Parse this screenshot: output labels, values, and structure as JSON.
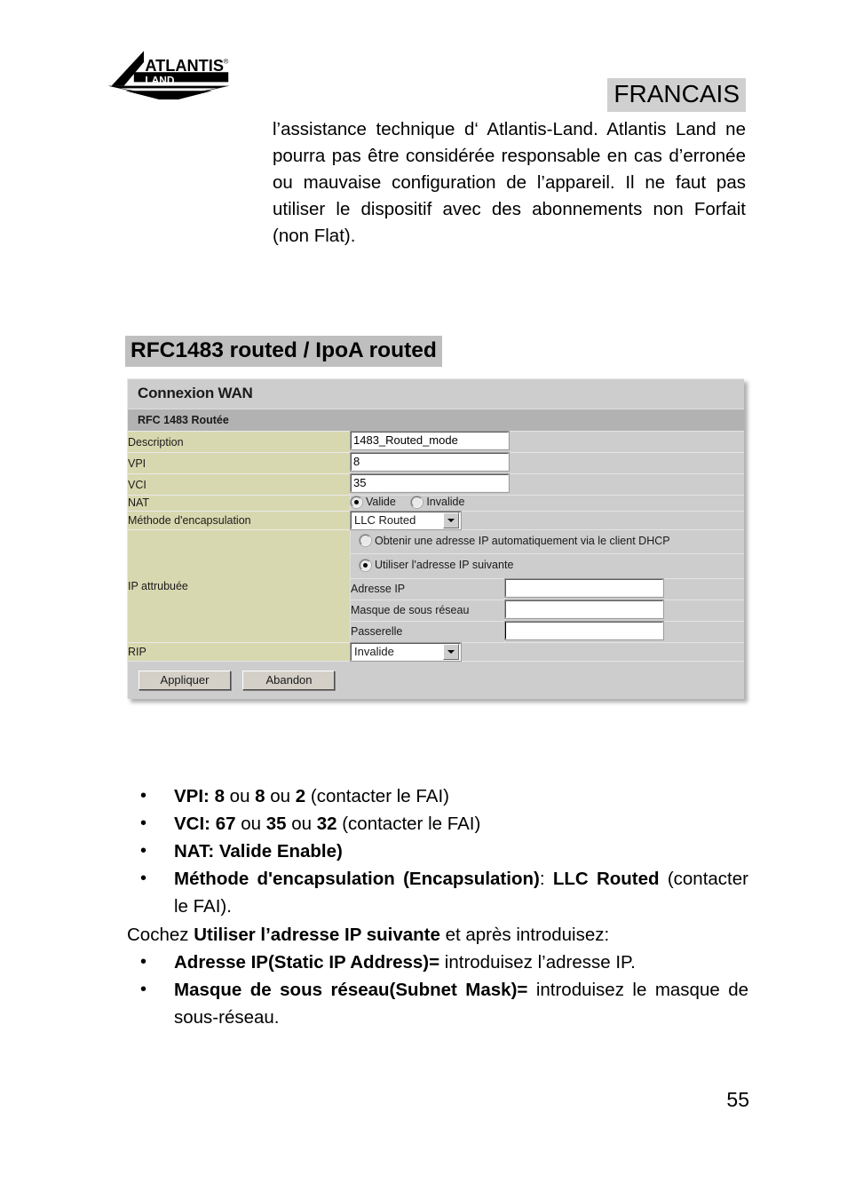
{
  "header": {
    "logo_alt": "ATLANTIS LAND",
    "logo_text_top": "ATLANTIS",
    "logo_text_bottom": "LAND",
    "logo_registered": "®",
    "language_badge": "FRANCAIS"
  },
  "intro": {
    "paragraph": "l’assistance technique d‘ Atlantis-Land. Atlantis Land ne pourra pas être considérée responsable en cas d’erronée ou mauvaise configuration de l’appareil. Il ne faut pas utiliser le dispositif avec des abonnements non Forfait (non Flat)."
  },
  "section": {
    "heading": "RFC1483 routed / IpoA routed"
  },
  "panel": {
    "title": "Connexion WAN",
    "subtitle": "RFC 1483 Routée",
    "rows": {
      "description": {
        "label": "Description",
        "value": "1483_Routed_mode"
      },
      "vpi": {
        "label": "VPI",
        "value": "8"
      },
      "vci": {
        "label": "VCI",
        "value": "35"
      },
      "nat": {
        "label": "NAT",
        "options": [
          {
            "label": "Valide",
            "selected": true
          },
          {
            "label": "Invalide",
            "selected": false
          }
        ]
      },
      "encapsulation": {
        "label": "Méthode d'encapsulation",
        "value": "LLC Routed"
      },
      "ip_assigned": {
        "label": "IP attrubuée",
        "radio_dhcp": {
          "label": "Obtenir une adresse IP automatiquement via le client DHCP",
          "selected": false
        },
        "radio_static": {
          "label": "Utiliser l'adresse IP suivante",
          "selected": true
        },
        "fields": [
          {
            "label": "Adresse IP",
            "value": ""
          },
          {
            "label": "Masque de sous réseau",
            "value": ""
          },
          {
            "label": "Passerelle",
            "value": ""
          }
        ]
      },
      "rip": {
        "label": "RIP",
        "value": "Invalide"
      }
    },
    "buttons": {
      "apply": "Appliquer",
      "cancel": "Abandon"
    }
  },
  "notes": {
    "bullet_marker": "•",
    "items": [
      {
        "bold_lead": "VPI: 8",
        "rest_1": " ou ",
        "bold_2": "8",
        "rest_2": " ou ",
        "bold_3": "2",
        "rest_3": " (contacter le FAI)"
      },
      {
        "bold_lead": "VCI: 67",
        "rest_1": " ou ",
        "bold_2": "35",
        "rest_2": " ou ",
        "bold_3": "32",
        "rest_3": " (contacter le FAI)"
      },
      {
        "bold_lead": "NAT: Valide Enable)",
        "rest_1": "",
        "bold_2": "",
        "rest_2": "",
        "bold_3": "",
        "rest_3": ""
      }
    ],
    "encap_bullet": {
      "bold_a": "Méthode d'encapsulation (Encapsulation)",
      "plain_a": ": ",
      "bold_b": "LLC Routed",
      "plain_b": " (contacter le FAI)."
    },
    "cochez_line": {
      "lead": "Cochez ",
      "bold": "Utiliser l’adresse IP suivante",
      "tail": "  et après introduisez:"
    },
    "ip_bullet": {
      "bold": "Adresse IP(Static IP Address)=",
      "plain": " introduisez l’adresse IP."
    },
    "mask_bullet": {
      "bold": "Masque de sous réseau(Subnet Mask)=",
      "plain": " introduisez le masque de sous-réseau."
    }
  },
  "footer": {
    "page_number": "55"
  }
}
